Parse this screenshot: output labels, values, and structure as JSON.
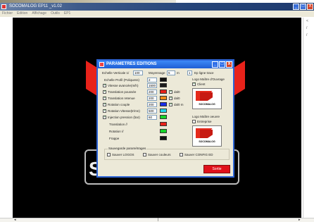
{
  "app": {
    "title": "SOCOMALOG EP11 _v1.02",
    "menu": [
      "Fichier",
      "Edition",
      "Affichage",
      "Outils",
      "EP1"
    ],
    "window_buttons": [
      "_",
      "□",
      "X"
    ]
  },
  "right_scroll": {
    "marks": [
      "<",
      "/",
      "/"
    ]
  },
  "hscroll": {
    "left": "◂",
    "mid": "|",
    "right": "▸"
  },
  "dialog": {
    "title": "PARAMETRES EDITIONS",
    "buttons": [
      "_",
      "□",
      "X"
    ],
    "echelle_verticale_label": "Echelle Verticale 1/",
    "echelle_verticale_value": "100",
    "moyennage_label": "Moyennage",
    "moyennage_value": "5",
    "unit_m": "m",
    "ep_ligne_label": "Ep ligne trace",
    "ep_ligne_value": "1",
    "echelle_profil_label": "Echelle Profil (Poliquess)",
    "echelle_profil_value": "2",
    "rows": [
      {
        "label": "Vitesse avancée(m/h)",
        "value": "1500",
        "checked": true,
        "color": "#1c1c1c",
        "extra": ""
      },
      {
        "label": "Translation poussée",
        "value": "200",
        "checked": true,
        "color": "#e8221a",
        "extra": "dal0"
      },
      {
        "label": "Translation retenue",
        "value": "200",
        "checked": true,
        "color": "#f08a1a",
        "extra": "dal0"
      },
      {
        "label": "Rotation couple",
        "value": "200",
        "checked": true,
        "color": "#1a2ee8",
        "extra": "dal0 m"
      },
      {
        "label": "Rotation Vitesse(tr/mn)",
        "value": "500",
        "checked": true,
        "color": "#22d3e8",
        "extra": ""
      },
      {
        "label": "Injection pression (bar)",
        "value": "60",
        "checked": true,
        "color": "#16d42a",
        "extra": ""
      }
    ],
    "plain_rows": [
      {
        "label": "Translation //",
        "color": "#e8221a"
      },
      {
        "label": "Rotation //",
        "color": "#16d42a"
      },
      {
        "label": "Frappe",
        "color": "#111111"
      }
    ],
    "logo_client": {
      "title": "Logo Maître d'Ouvrage",
      "check": "Client",
      "name": "SOCOMALOG"
    },
    "logo_entreprise": {
      "title": "Logo Maître oeuvre",
      "check": "Entreprise",
      "name": "SOCOMALOG"
    },
    "sauvegarde": {
      "title": "Sauvegarde paramétrages",
      "options": [
        "Sauver LOGOS",
        "Sauver couleurs",
        "Sauver CONFIG ED"
      ]
    },
    "sortie_label": "Sortie"
  }
}
